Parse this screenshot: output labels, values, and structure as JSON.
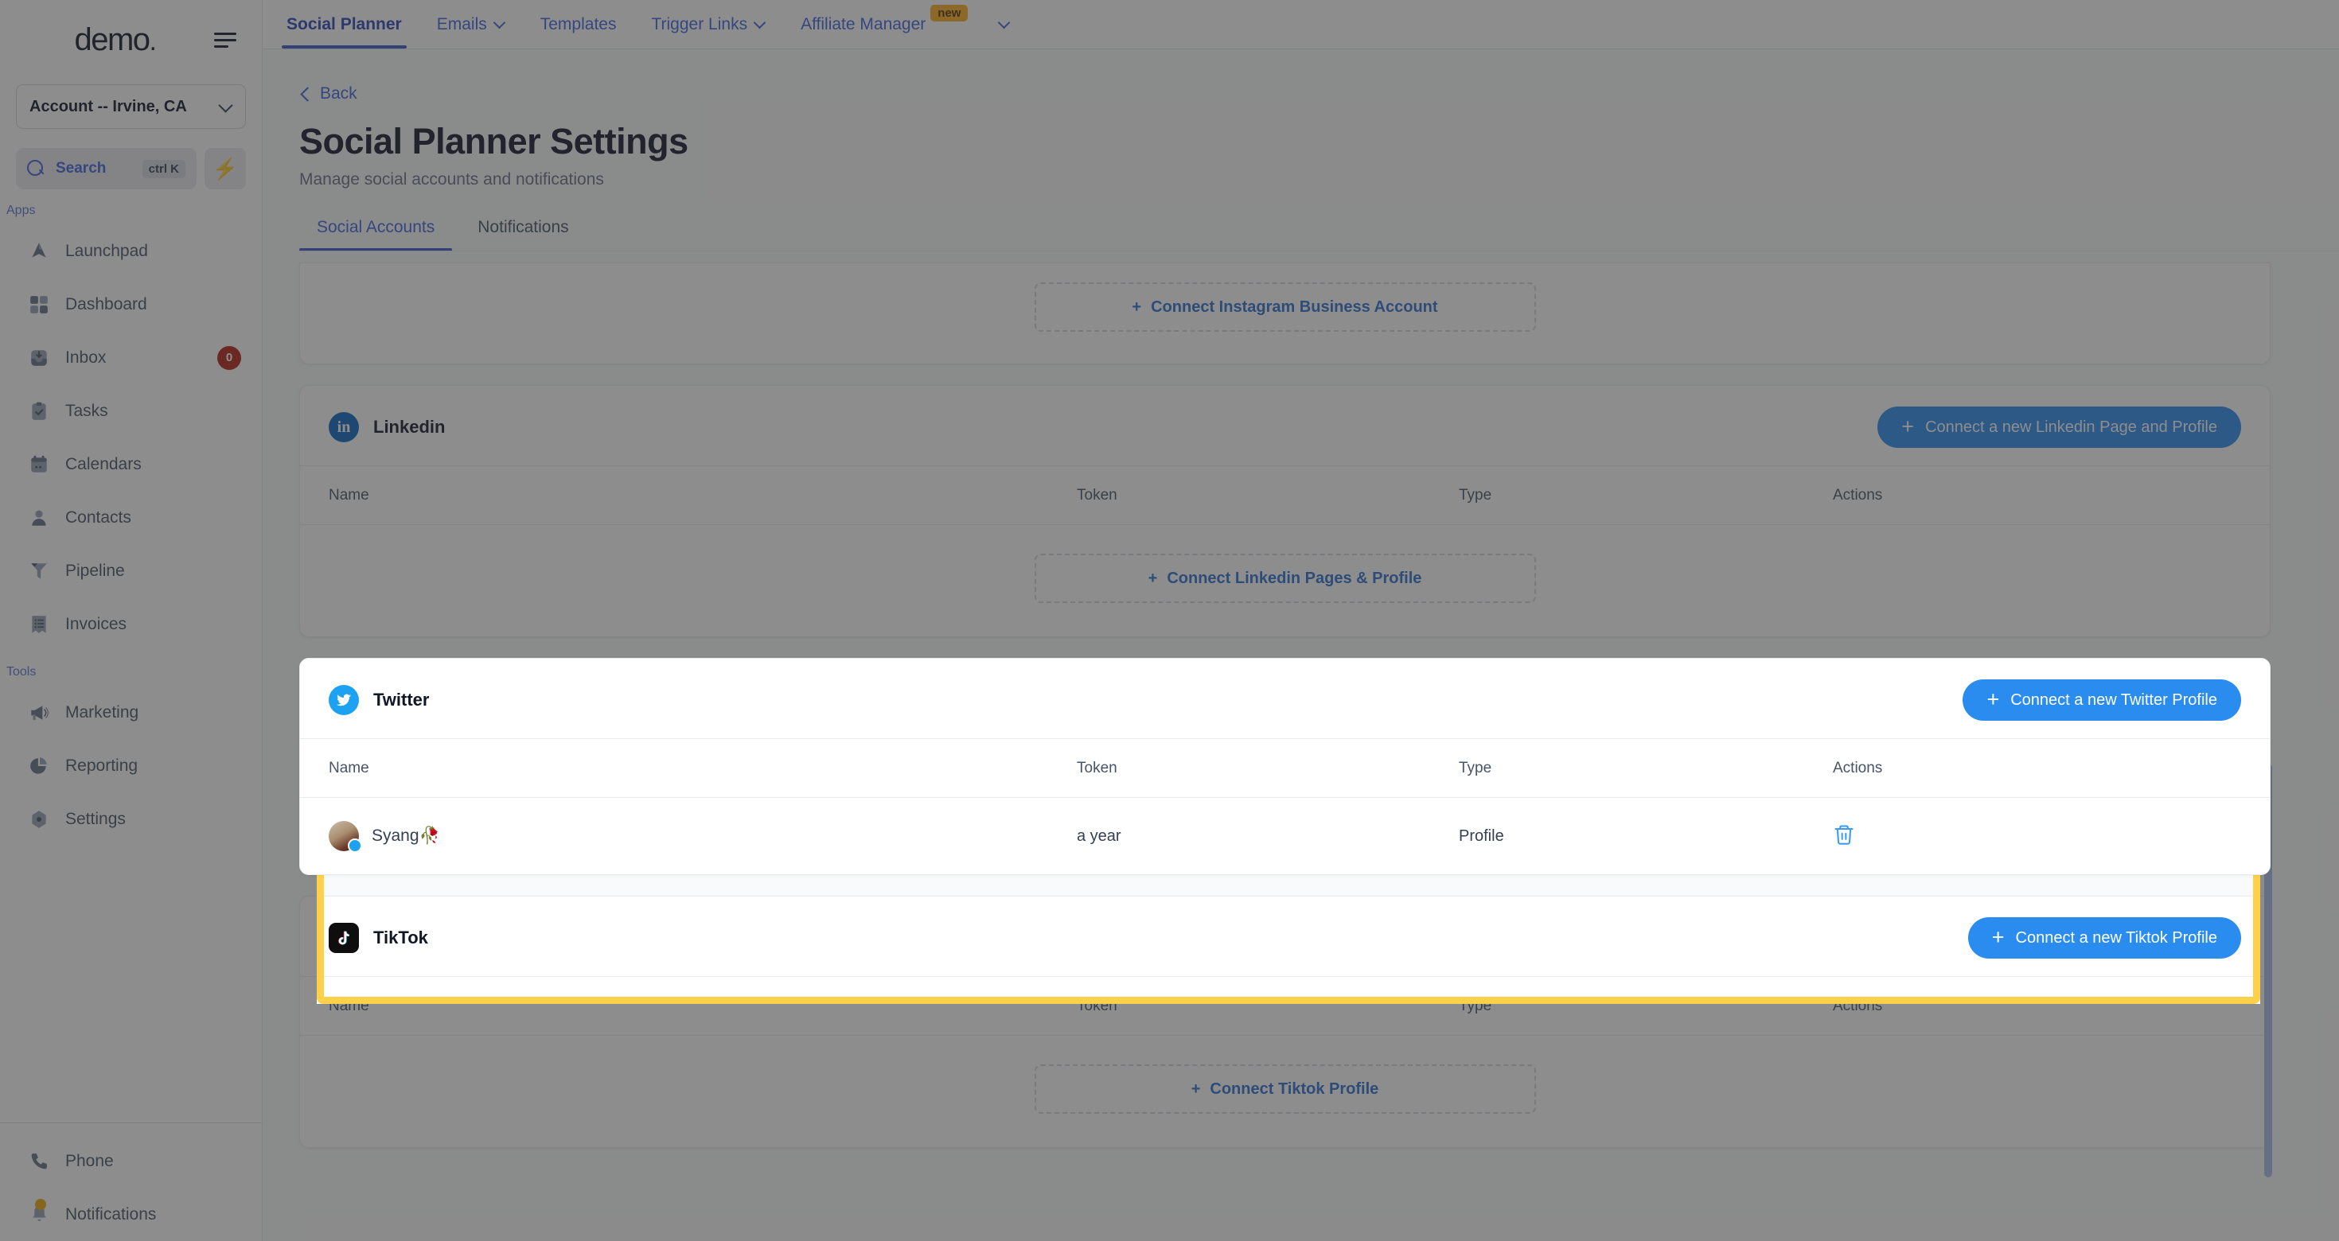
{
  "sidebar": {
    "logo": "demo",
    "logo_dot": ".",
    "account_selector": "Account -- Irvine, CA",
    "search": {
      "label": "Search",
      "shortcut": "ctrl K"
    },
    "groups": [
      {
        "label": "Apps",
        "items": [
          {
            "label": "Launchpad",
            "icon": "launchpad-icon",
            "badge": ""
          },
          {
            "label": "Dashboard",
            "icon": "dashboard-icon",
            "badge": ""
          },
          {
            "label": "Inbox",
            "icon": "inbox-icon",
            "badge": "0"
          },
          {
            "label": "Tasks",
            "icon": "tasks-icon",
            "badge": ""
          },
          {
            "label": "Calendars",
            "icon": "calendar-icon",
            "badge": ""
          },
          {
            "label": "Contacts",
            "icon": "contacts-icon",
            "badge": ""
          },
          {
            "label": "Pipeline",
            "icon": "pipeline-icon",
            "badge": ""
          },
          {
            "label": "Invoices",
            "icon": "invoices-icon",
            "badge": ""
          }
        ]
      },
      {
        "label": "Tools",
        "items": [
          {
            "label": "Marketing",
            "icon": "megaphone-icon",
            "badge": ""
          },
          {
            "label": "Reporting",
            "icon": "pie-chart-icon",
            "badge": ""
          },
          {
            "label": "Settings",
            "icon": "gear-icon",
            "badge": ""
          }
        ]
      }
    ],
    "bottom_items": [
      {
        "label": "Phone",
        "icon": "phone-icon",
        "dot": false
      },
      {
        "label": "Notifications",
        "icon": "bell-icon",
        "dot": true
      }
    ]
  },
  "topnav": {
    "tabs": [
      {
        "label": "Social Planner",
        "active": true,
        "caret": false,
        "badge": ""
      },
      {
        "label": "Emails",
        "active": false,
        "caret": true,
        "badge": ""
      },
      {
        "label": "Templates",
        "active": false,
        "caret": false,
        "badge": ""
      },
      {
        "label": "Trigger Links",
        "active": false,
        "caret": true,
        "badge": ""
      },
      {
        "label": "Affiliate Manager",
        "active": false,
        "caret": false,
        "badge": "new"
      }
    ],
    "overflow_caret": "chevron-down-icon"
  },
  "page": {
    "back_label": "Back",
    "title": "Social Planner Settings",
    "subtitle": "Manage social accounts and notifications",
    "tabs": [
      {
        "label": "Social Accounts",
        "active": true
      },
      {
        "label": "Notifications",
        "active": false
      }
    ]
  },
  "table_headers": {
    "name": "Name",
    "token": "Token",
    "type": "Type",
    "actions": "Actions"
  },
  "sections": [
    {
      "id": "instagram",
      "platform": "Instagram",
      "connect_dashed": "Connect Instagram Business Account",
      "has_header": false,
      "rows": []
    },
    {
      "id": "linkedin",
      "platform": "Linkedin",
      "connect_button": "Connect a new Linkedin Page and Profile",
      "connect_dashed": "Connect Linkedin Pages & Profile",
      "has_header": true,
      "rows": []
    },
    {
      "id": "twitter",
      "platform": "Twitter",
      "connect_button": "Connect a new Twitter Profile",
      "connect_dashed": "",
      "has_header": true,
      "highlighted": true,
      "rows": [
        {
          "name": "Syang🥀",
          "token": "a year",
          "type": "Profile",
          "action": "delete-icon"
        }
      ]
    },
    {
      "id": "tiktok",
      "platform": "TikTok",
      "connect_button": "Connect a new Tiktok Profile",
      "connect_dashed": "Connect Tiktok Profile",
      "has_header": true,
      "rows": []
    }
  ],
  "colors": {
    "accent_blue": "#3e63dd",
    "button_blue": "#2b8cf0",
    "highlight_yellow": "#ffd04a",
    "badge_red": "#b42318",
    "new_badge": "#fdb022",
    "linkedin": "#0a66c2",
    "twitter": "#1da1f2"
  }
}
